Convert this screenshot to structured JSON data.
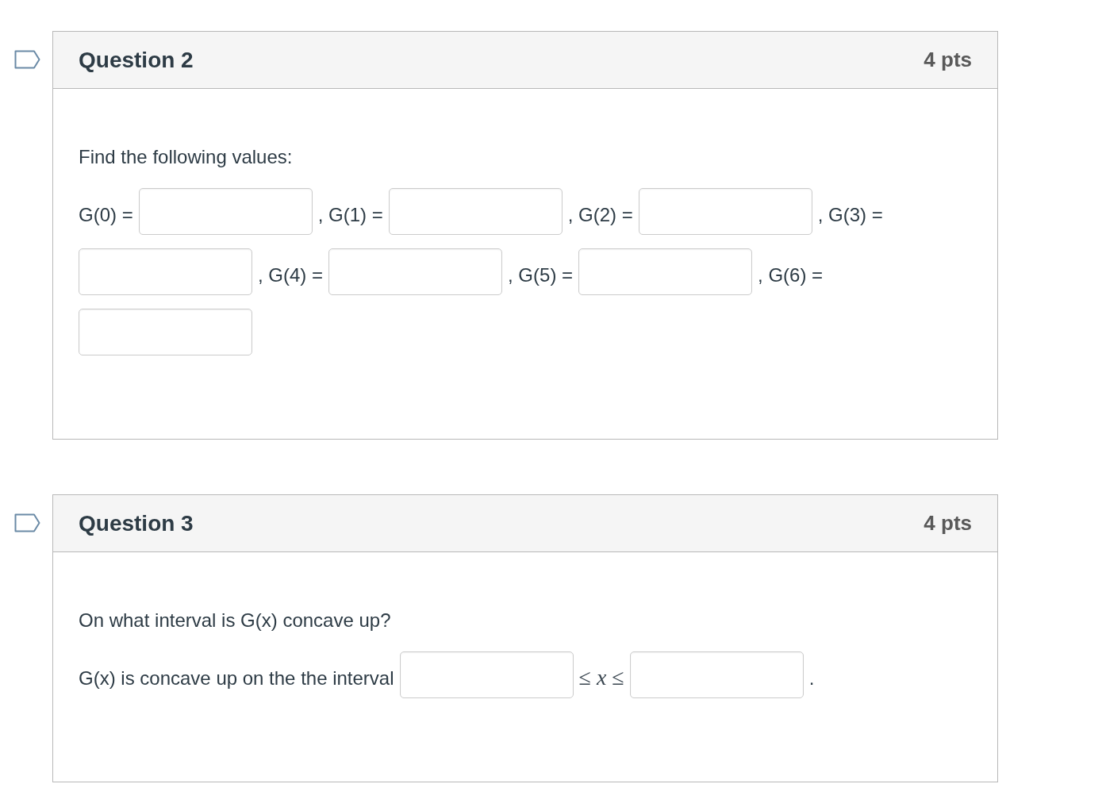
{
  "questions": [
    {
      "flagged": false,
      "title": "Question 2",
      "points": "4 pts",
      "prompt": "Find the following values:",
      "parts": [
        {
          "kind": "text",
          "text": "G(0) ="
        },
        {
          "kind": "field"
        },
        {
          "kind": "text",
          "text": ", G(1) ="
        },
        {
          "kind": "field"
        },
        {
          "kind": "text",
          "text": ", G(2) ="
        },
        {
          "kind": "field"
        },
        {
          "kind": "text",
          "text": ", G(3) ="
        },
        {
          "kind": "field"
        },
        {
          "kind": "text",
          "text": ", G(4) ="
        },
        {
          "kind": "field"
        },
        {
          "kind": "text",
          "text": ", G(5) ="
        },
        {
          "kind": "field"
        },
        {
          "kind": "text",
          "text": ", G(6) ="
        },
        {
          "kind": "field"
        }
      ]
    },
    {
      "flagged": false,
      "title": "Question 3",
      "points": "4 pts",
      "prompt": "On what interval is G(x) concave up?",
      "parts": [
        {
          "kind": "text",
          "text": "G(x) is concave up on the the interval"
        },
        {
          "kind": "field"
        },
        {
          "kind": "math",
          "text": "≤ *x* ≤"
        },
        {
          "kind": "field"
        },
        {
          "kind": "text",
          "text": "."
        }
      ]
    }
  ]
}
